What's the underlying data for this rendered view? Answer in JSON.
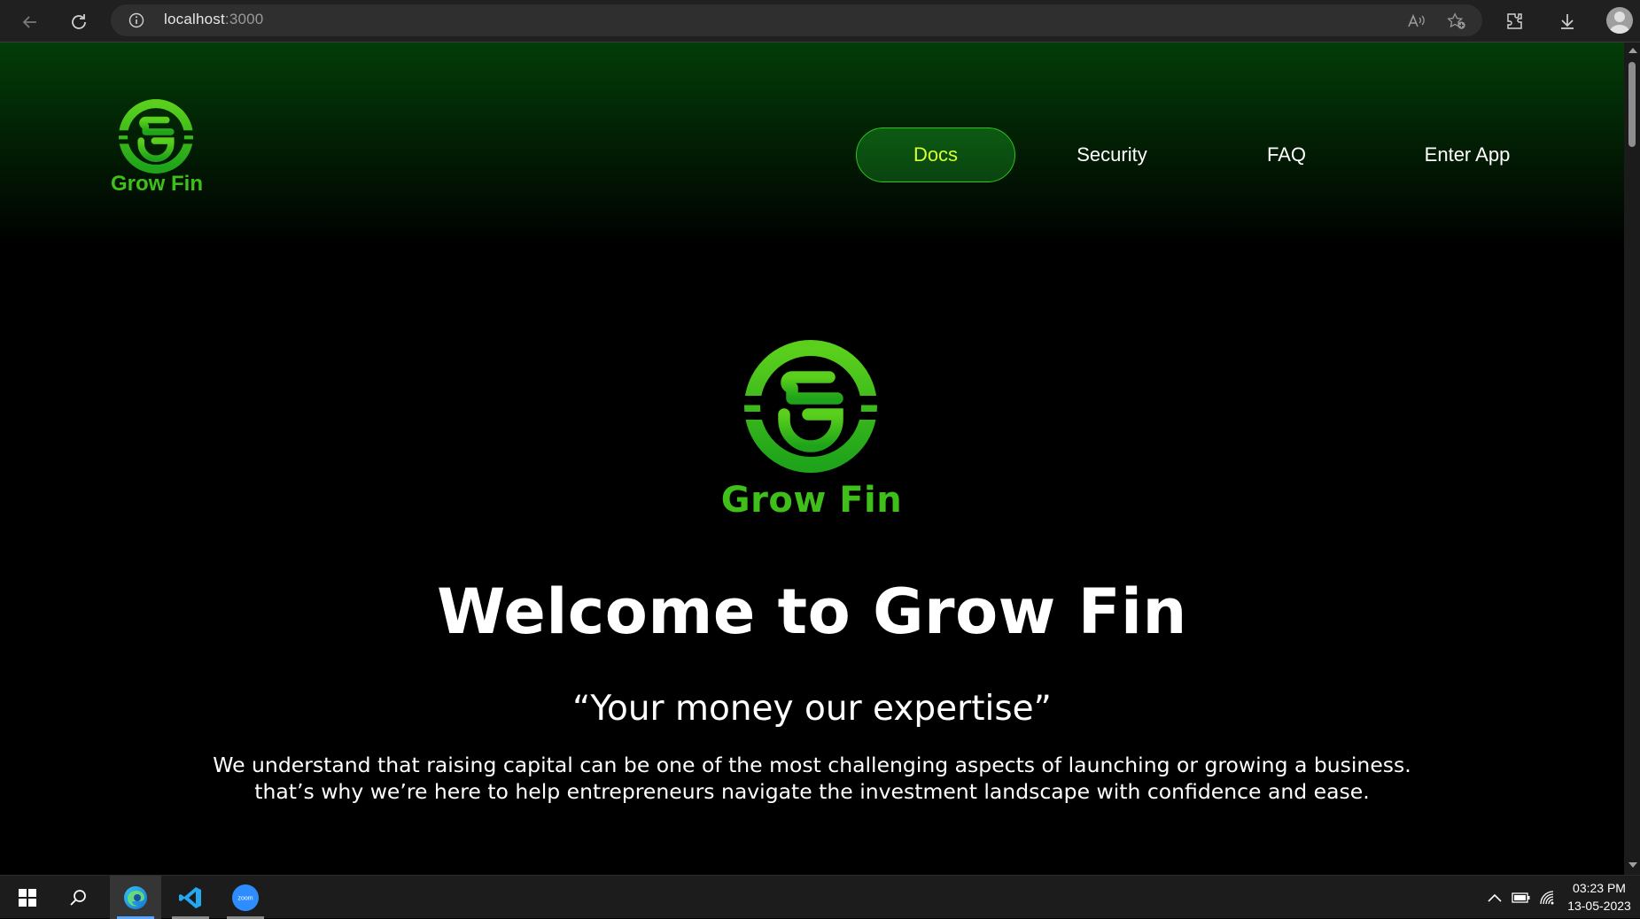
{
  "browser": {
    "url_host": "localhost",
    "url_port": ":3000"
  },
  "header": {
    "brand_name": "Grow Fin",
    "nav": [
      {
        "label": "Docs",
        "active": true
      },
      {
        "label": "Security",
        "active": false
      },
      {
        "label": "FAQ",
        "active": false
      },
      {
        "label": "Enter App",
        "active": false
      }
    ]
  },
  "hero": {
    "brand_name": "Grow Fin",
    "title": "Welcome to Grow Fin",
    "tagline": "“Your money our expertise”",
    "description": "We understand that raising capital can be one of the most challenging aspects of launching or growing a business. that’s why we’re here to help entrepreneurs navigate the investment landscape with confidence and ease."
  },
  "taskbar": {
    "apps": [
      "start-icon",
      "search-icon",
      "edge-icon",
      "vscode-icon",
      "zoom-icon"
    ],
    "zoom_label": "zoom",
    "time": "03:23 PM",
    "date": "13-05-2023"
  },
  "colors": {
    "brand_green": "#3fbf1a",
    "nav_active_text": "#d8ff3a",
    "nav_active_border": "#2dc41c",
    "header_gradient_top": "#033d08",
    "background": "#000000"
  }
}
